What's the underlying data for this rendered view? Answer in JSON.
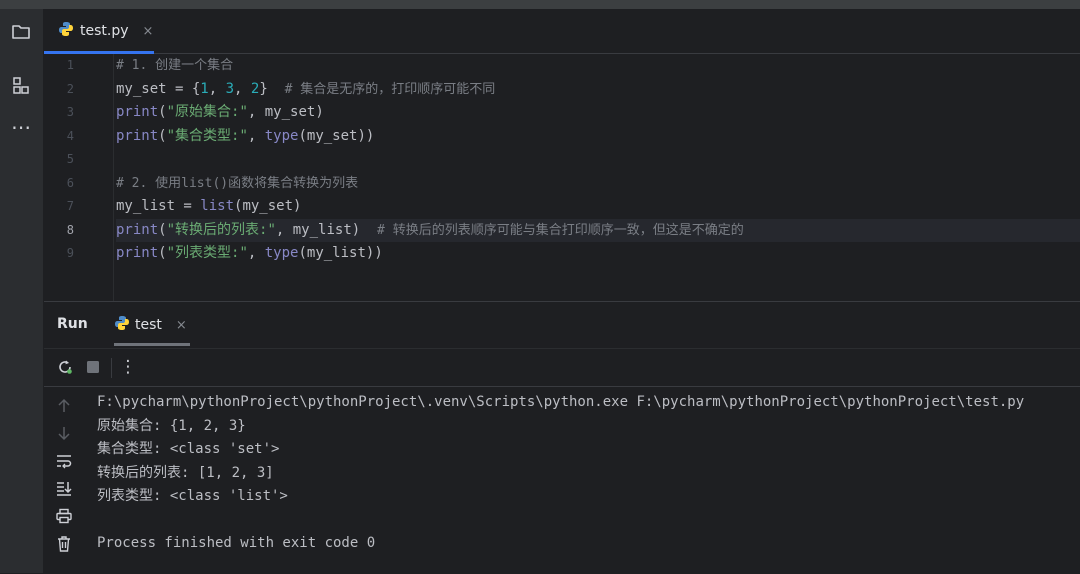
{
  "editor": {
    "tab": {
      "filename": "test.py",
      "close": "×"
    },
    "line_numbers": [
      "1",
      "2",
      "3",
      "4",
      "5",
      "6",
      "7",
      "8",
      "9"
    ],
    "current_line": 8,
    "lines": [
      [
        {
          "t": "# 1. 创建一个集合",
          "c": "cm"
        }
      ],
      [
        {
          "t": "my_set = {",
          "c": "txt"
        },
        {
          "t": "1",
          "c": "num"
        },
        {
          "t": ", ",
          "c": "txt"
        },
        {
          "t": "3",
          "c": "num"
        },
        {
          "t": ", ",
          "c": "txt"
        },
        {
          "t": "2",
          "c": "num"
        },
        {
          "t": "}  ",
          "c": "txt"
        },
        {
          "t": "# 集合是无序的，打印顺序可能不同",
          "c": "cm"
        }
      ],
      [
        {
          "t": "print",
          "c": "kw"
        },
        {
          "t": "(",
          "c": "txt"
        },
        {
          "t": "\"原始集合:\"",
          "c": "str"
        },
        {
          "t": ", my_set)",
          "c": "txt"
        }
      ],
      [
        {
          "t": "print",
          "c": "kw"
        },
        {
          "t": "(",
          "c": "txt"
        },
        {
          "t": "\"集合类型:\"",
          "c": "str"
        },
        {
          "t": ", ",
          "c": "txt"
        },
        {
          "t": "type",
          "c": "kw"
        },
        {
          "t": "(my_set))",
          "c": "txt"
        }
      ],
      [],
      [
        {
          "t": "# 2. 使用list()函数将集合转换为列表",
          "c": "cm"
        }
      ],
      [
        {
          "t": "my_list = ",
          "c": "txt"
        },
        {
          "t": "list",
          "c": "kw"
        },
        {
          "t": "(my_set)",
          "c": "txt"
        }
      ],
      [
        {
          "t": "print",
          "c": "kw"
        },
        {
          "t": "(",
          "c": "txt"
        },
        {
          "t": "\"转换后的列表:\"",
          "c": "str"
        },
        {
          "t": ", my_list)  ",
          "c": "txt"
        },
        {
          "t": "# 转换后的列表顺序可能与集合打印顺序一致，但这是不确定的",
          "c": "cm"
        }
      ],
      [
        {
          "t": "print",
          "c": "kw"
        },
        {
          "t": "(",
          "c": "txt"
        },
        {
          "t": "\"列表类型:\"",
          "c": "str"
        },
        {
          "t": ", ",
          "c": "txt"
        },
        {
          "t": "type",
          "c": "kw"
        },
        {
          "t": "(my_list))",
          "c": "txt"
        }
      ]
    ]
  },
  "run": {
    "title": "Run",
    "tab_label": "test",
    "tab_close": "×",
    "more": "⋮",
    "output": [
      "F:\\pycharm\\pythonProject\\pythonProject\\.venv\\Scripts\\python.exe F:\\pycharm\\pythonProject\\pythonProject\\test.py",
      "原始集合: {1, 2, 3}",
      "集合类型: <class 'set'>",
      "转换后的列表: [1, 2, 3]",
      "列表类型: <class 'list'>",
      "",
      "Process finished with exit code 0"
    ]
  },
  "activity_bar": {
    "more": "⋯"
  },
  "colors": {
    "accent": "#3574f0",
    "string": "#6aab73",
    "keyword": "#8888c6",
    "number": "#2aacb8",
    "comment": "#7a7e85"
  }
}
